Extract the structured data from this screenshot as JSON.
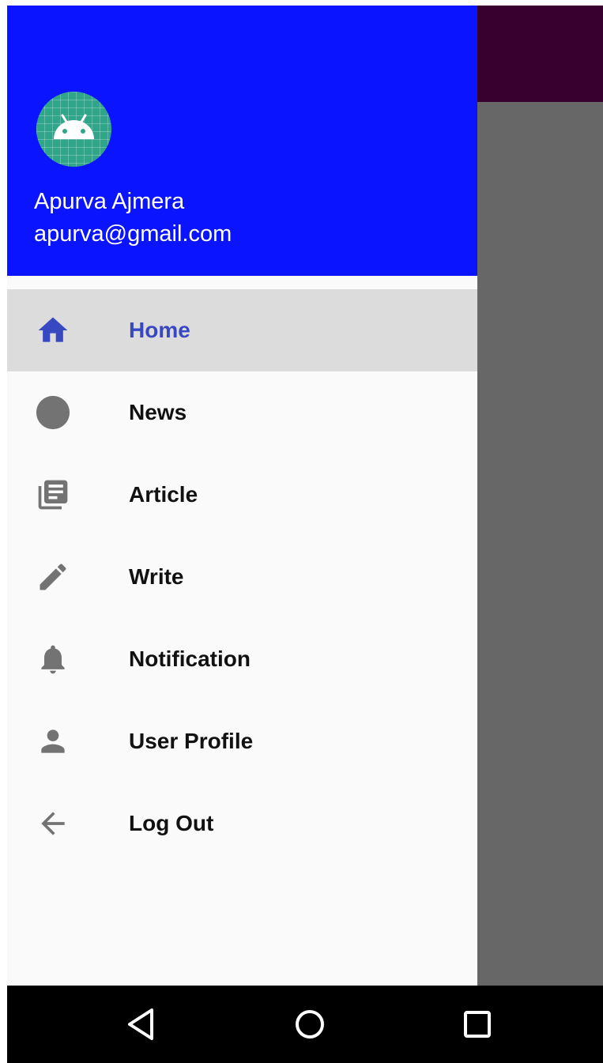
{
  "header": {
    "user_name": "Apurva Ajmera",
    "user_email": "apurva@gmail.com",
    "avatar_icon": "android-icon",
    "background_color": "#0a14ff"
  },
  "menu": {
    "items": [
      {
        "label": "Home",
        "icon": "home-icon",
        "selected": true
      },
      {
        "label": "News",
        "icon": "circle-icon",
        "selected": false
      },
      {
        "label": "Article",
        "icon": "library-books-icon",
        "selected": false
      },
      {
        "label": "Write",
        "icon": "pencil-icon",
        "selected": false
      },
      {
        "label": "Notification",
        "icon": "bell-icon",
        "selected": false
      },
      {
        "label": "User Profile",
        "icon": "person-icon",
        "selected": false
      },
      {
        "label": "Log Out",
        "icon": "arrow-back-icon",
        "selected": false
      }
    ],
    "selected_color": "#3848c0",
    "icon_color": "#737373"
  },
  "nav_bar": {
    "buttons": [
      "back-icon",
      "home-circle-icon",
      "recents-icon"
    ]
  },
  "app": {
    "toolbar_color": "#38002f"
  }
}
